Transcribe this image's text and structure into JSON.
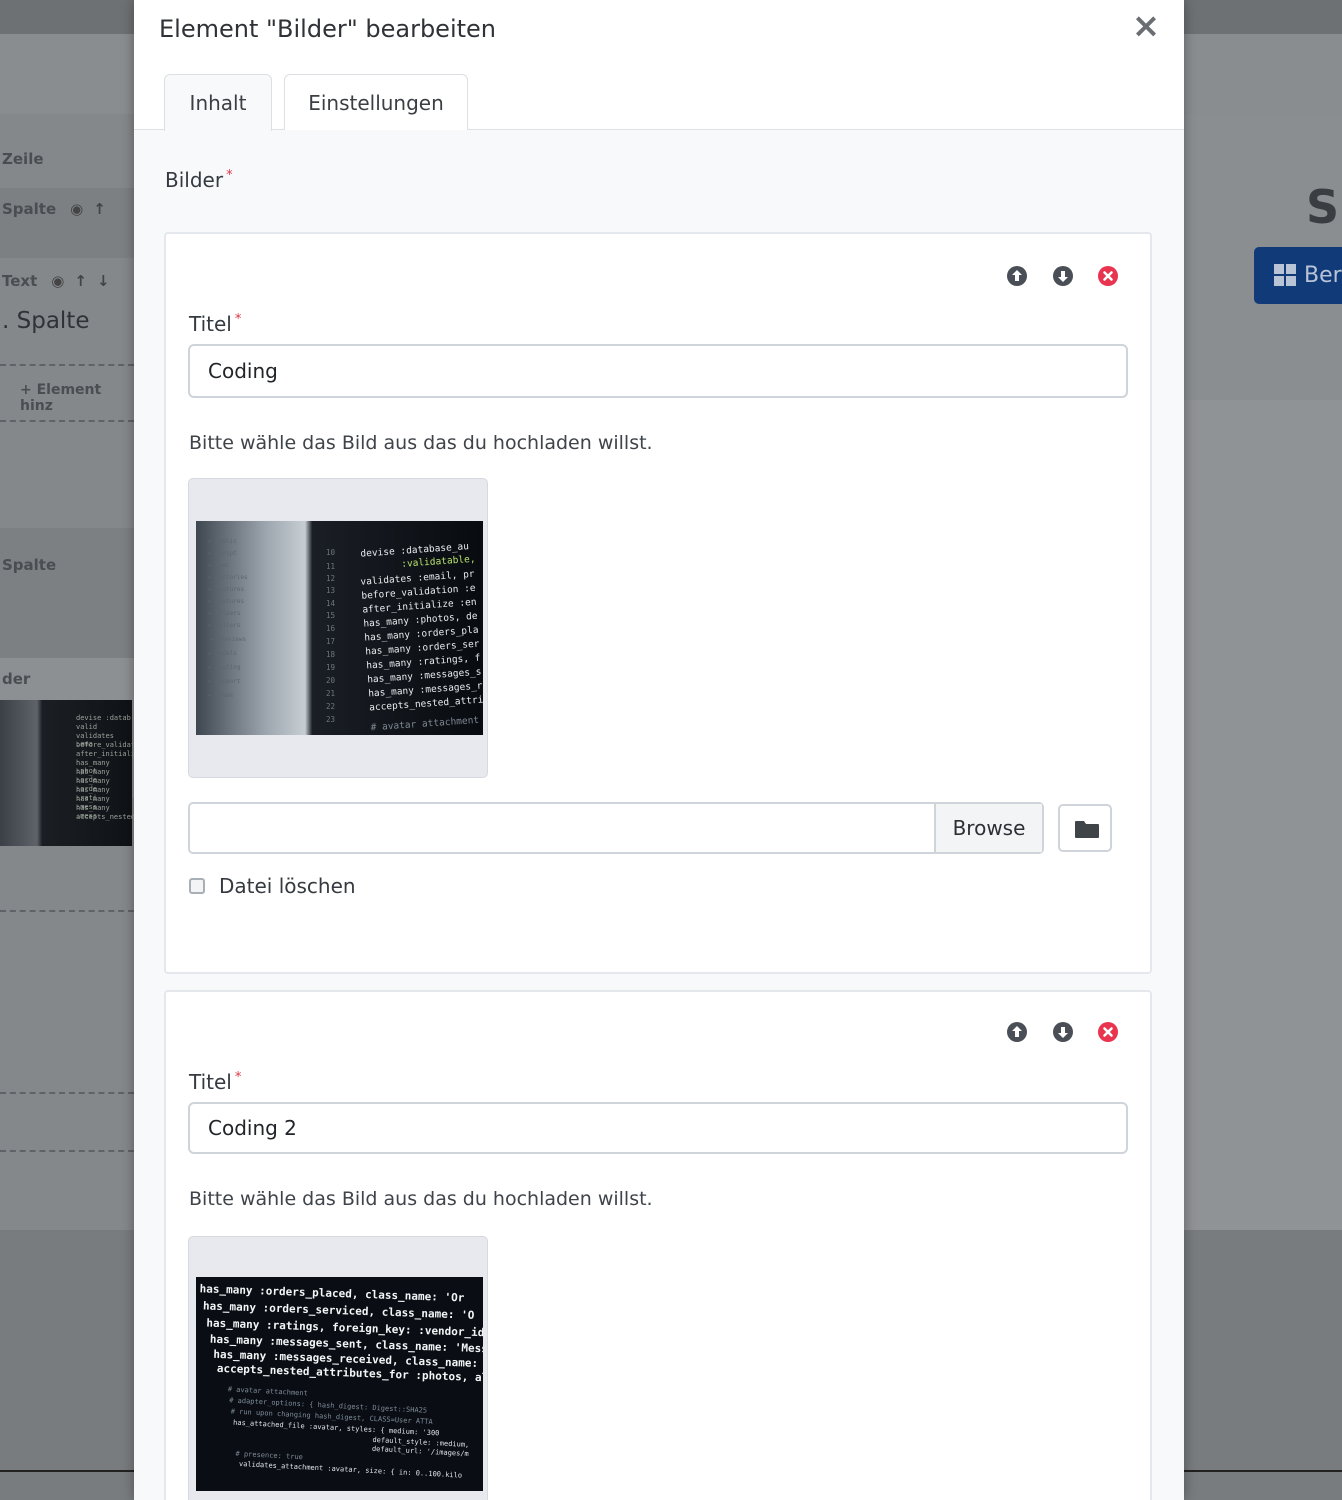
{
  "background": {
    "rows": [
      "Zeile",
      "Spalte",
      "Text",
      "Spalte",
      "der"
    ],
    "column_title": ". Spalte",
    "add_element": "+ Element hinz",
    "right_title": "Si",
    "right_button": "Ber",
    "code_snippet": [
      "devise :datab",
      "valid",
      "validates :ema",
      "before_validat",
      "after_initiali",
      "has_many :phot",
      "has_many :orde",
      "has_many :orde",
      "has_many :rati",
      "has_many :mess",
      "has_many :mess",
      "accepts_nested_"
    ]
  },
  "modal": {
    "title": "Element \"Bilder\" bearbeiten",
    "close_label": "×",
    "tabs": [
      {
        "label": "Inhalt",
        "active": true
      },
      {
        "label": "Einstellungen",
        "active": false
      }
    ],
    "section_label": "Bilder",
    "required_mark": "*",
    "items": [
      {
        "title_label": "Titel",
        "title_value": "Coding",
        "hint": "Bitte wähle das Bild aus das du hochladen willst.",
        "browse_label": "Browse",
        "file_value": "",
        "delete_label": "Datei löschen",
        "image_caption_code": [
          "devise :database_au",
          ":validatable,",
          "validates :email, pr",
          "before_validation :e",
          "after_initialize :en",
          "has_many :photos, de",
          "has_many :orders_pla",
          "has_many :orders_ser",
          "has_many :ratings, f",
          "has_many :messages_s",
          "has_many :messages_re",
          "accepts_nested_attrib",
          "# avatar attachment"
        ],
        "line_numbers": [
          "10",
          "11",
          "12",
          "13",
          "14",
          "15",
          "16",
          "17",
          "18",
          "19",
          "20",
          "21",
          "22",
          "23"
        ]
      },
      {
        "title_label": "Titel",
        "title_value": "Coding 2",
        "hint": "Bitte wähle das Bild aus das du hochladen willst.",
        "image_caption_code": [
          "has_many :orders_placed, class_name: 'Or",
          "has_many :orders_serviced, class_name: 'O",
          "has_many :ratings, foreign_key: :vendor_id",
          "has_many :messages_sent, class_name: 'Messa",
          "has_many :messages_received, class_name: 'Me",
          "accepts_nested_attributes_for :photos, allow_",
          "# avatar attachment",
          "# adapter_options: { hash_digest: Digest::SHA25",
          "# run upon changing hash_digest, CLASS=User ATTA",
          "has_attached_file :avatar, styles: { medium: '300",
          "default_style: :medium,",
          "default_url: '/images/m",
          "# presence: true",
          "validates_attachment :avatar, size: { in: 0..100.kilo"
        ]
      }
    ]
  },
  "colors": {
    "accent_blue": "#103a78",
    "required_red": "#dc3545",
    "delete_red": "#e8344f",
    "move_gray": "#4a4f57"
  }
}
